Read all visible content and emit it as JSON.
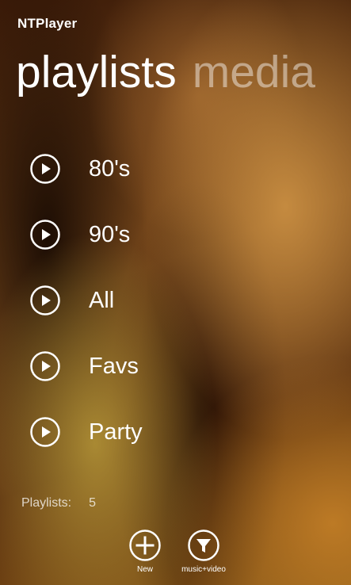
{
  "app": {
    "title": "NTPlayer"
  },
  "pivot": {
    "headers": [
      {
        "label": "playlists",
        "active": true
      },
      {
        "label": "media",
        "active": false
      }
    ]
  },
  "playlists": {
    "items": [
      {
        "label": "80's",
        "icon": "play-icon"
      },
      {
        "label": "90's",
        "icon": "play-icon"
      },
      {
        "label": "All",
        "icon": "play-icon"
      },
      {
        "label": "Favs",
        "icon": "play-icon"
      },
      {
        "label": "Party",
        "icon": "play-icon"
      }
    ]
  },
  "stats": {
    "label": "Playlists:",
    "count": "5"
  },
  "appbar": {
    "buttons": [
      {
        "label": "New",
        "icon": "plus-icon"
      },
      {
        "label": "music+video",
        "icon": "filter-icon"
      }
    ]
  },
  "colors": {
    "foreground": "#ffffff",
    "inactive_header": "rgba(255,255,255,0.45)"
  }
}
